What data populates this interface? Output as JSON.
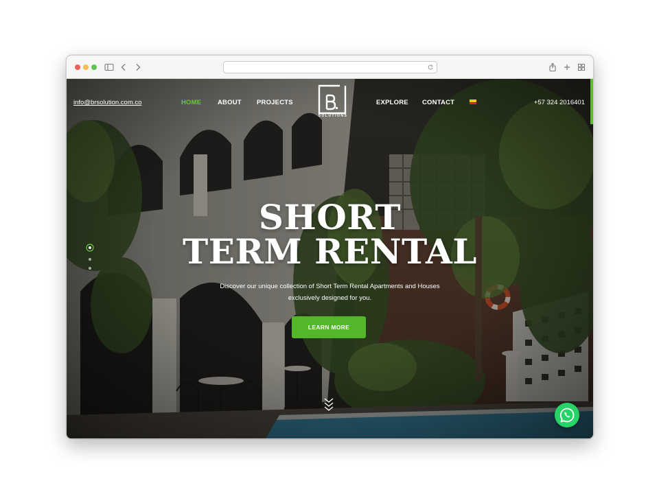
{
  "browser": {
    "url": "",
    "traffic_lights": [
      "#ee5f57",
      "#f4bd4f",
      "#5fc453"
    ]
  },
  "header": {
    "email": "info@brsolution.com.co",
    "nav_left": [
      "HOME",
      "ABOUT",
      "PROJECTS"
    ],
    "nav_right": [
      "EXPLORE",
      "CONTACT"
    ],
    "active_item": "HOME",
    "logo_text": "SOLUTIONS",
    "phone": "+57 324 2016401",
    "language_flag": "colombia-flag-icon"
  },
  "hero": {
    "title_line1": "SHORT",
    "title_line2": "TERM RENTAL",
    "subtitle_line1": "Discover our unique collection of Short Term Rental Apartments and Houses",
    "subtitle_line2": "exclusively designed for you.",
    "cta_label": "LEARN MORE"
  },
  "colors": {
    "accent": "#52b72a",
    "nav_active": "#6cc93a",
    "whatsapp": "#27d366"
  },
  "icons": [
    "sidebar-icon",
    "back-icon",
    "forward-icon",
    "reload-icon",
    "share-icon",
    "new-tab-icon",
    "tab-overview-icon",
    "scroll-down-icon",
    "whatsapp-icon"
  ]
}
